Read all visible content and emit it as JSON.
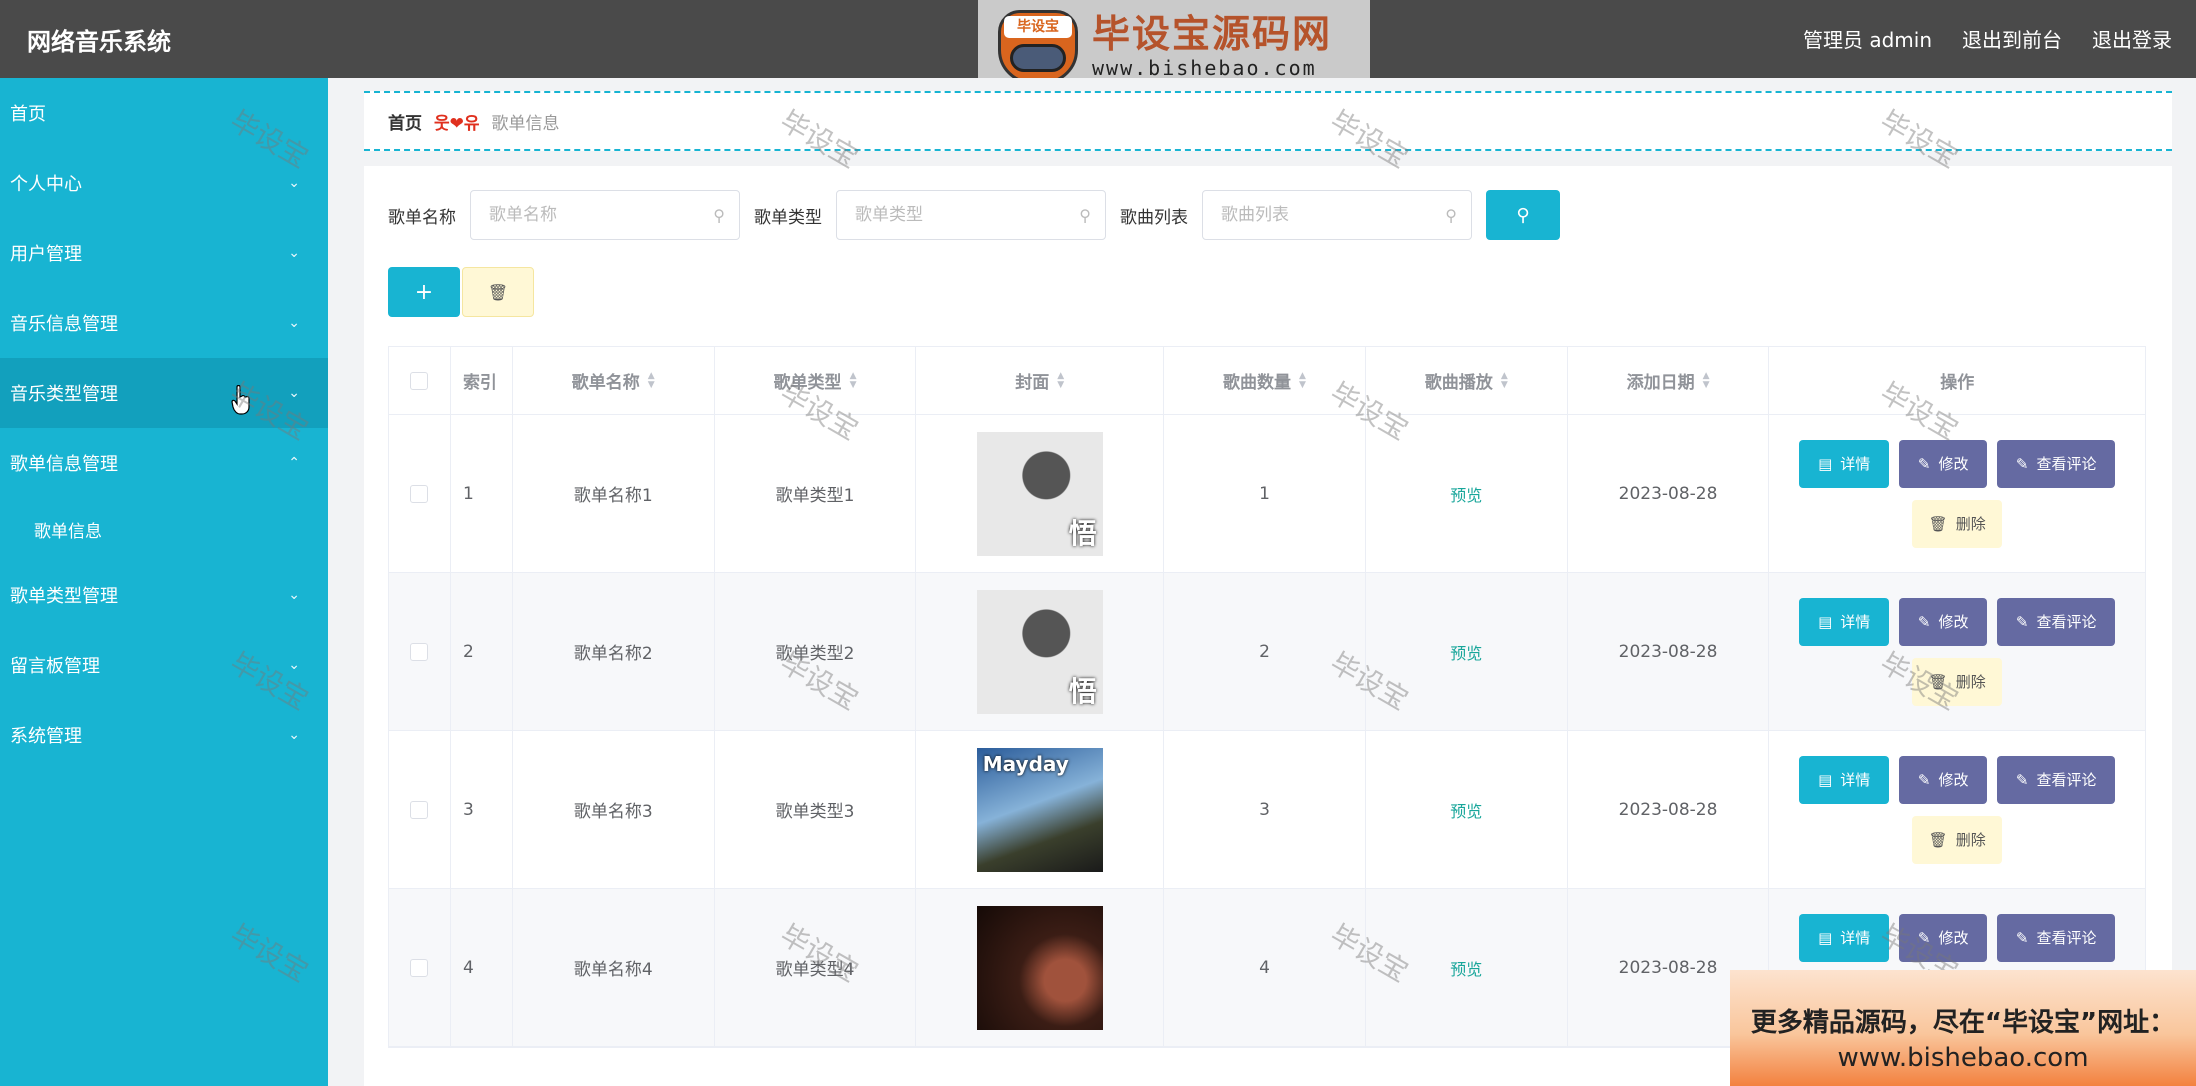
{
  "app": {
    "title": "网络音乐系统"
  },
  "header": {
    "admin_label": "管理员 admin",
    "front_label": "退出到前台",
    "logout_label": "退出登录"
  },
  "watermark_logo": {
    "tag": "毕设宝",
    "name": "毕设宝源码网",
    "url": "www.bishebao.com"
  },
  "sidebar": {
    "items": [
      {
        "label": "首页",
        "chevron": ""
      },
      {
        "label": "个人中心",
        "chevron": "⌄"
      },
      {
        "label": "用户管理",
        "chevron": "⌄"
      },
      {
        "label": "音乐信息管理",
        "chevron": "⌄"
      },
      {
        "label": "音乐类型管理",
        "chevron": "⌄"
      },
      {
        "label": "歌单信息管理",
        "chevron": "⌃"
      },
      {
        "label": "歌单类型管理",
        "chevron": "⌄"
      },
      {
        "label": "留言板管理",
        "chevron": "⌄"
      },
      {
        "label": "系统管理",
        "chevron": "⌄"
      }
    ],
    "sub_item": "歌单信息"
  },
  "breadcrumb": {
    "home": "首页",
    "separator": "웃❤유",
    "current": "歌单信息"
  },
  "search": {
    "fields": [
      {
        "label": "歌单名称",
        "placeholder": "歌单名称"
      },
      {
        "label": "歌单类型",
        "placeholder": "歌单类型"
      },
      {
        "label": "歌曲列表",
        "placeholder": "歌曲列表"
      }
    ],
    "button_icon": "search-icon"
  },
  "toolbar": {
    "add_icon": "+",
    "delete_icon": "trash-icon"
  },
  "table": {
    "headers": [
      "索引",
      "歌单名称",
      "歌单类型",
      "封面",
      "歌曲数量",
      "歌曲播放",
      "添加日期",
      "操作"
    ],
    "rows": [
      {
        "index": "1",
        "name": "歌单名称1",
        "type": "歌单类型1",
        "count": "1",
        "play": "预览",
        "date": "2023-08-28",
        "cover_text": "悟",
        "cover_style": "dark1"
      },
      {
        "index": "2",
        "name": "歌单名称2",
        "type": "歌单类型2",
        "count": "2",
        "play": "预览",
        "date": "2023-08-28",
        "cover_text": "悟",
        "cover_style": "dark1"
      },
      {
        "index": "3",
        "name": "歌单名称3",
        "type": "歌单类型3",
        "count": "3",
        "play": "预览",
        "date": "2023-08-28",
        "cover_text": "Mayday",
        "cover_style": "dark2"
      },
      {
        "index": "4",
        "name": "歌单名称4",
        "type": "歌单类型4",
        "count": "4",
        "play": "预览",
        "date": "2023-08-28",
        "cover_text": "",
        "cover_style": "dark3"
      }
    ],
    "ops": {
      "detail": "详情",
      "edit": "修改",
      "comment": "查看评论",
      "delete": "删除"
    }
  },
  "watermark_text": "毕设宝",
  "banner": {
    "line1": "更多精品源码，尽在“毕设宝”网址：",
    "line2": "www.bishebao.com"
  },
  "colors": {
    "primary": "#18b4d2",
    "topbar": "#4a4a4a",
    "edit": "#656aa2",
    "delete_bg": "#fff8d6",
    "preview": "#18a69a"
  }
}
